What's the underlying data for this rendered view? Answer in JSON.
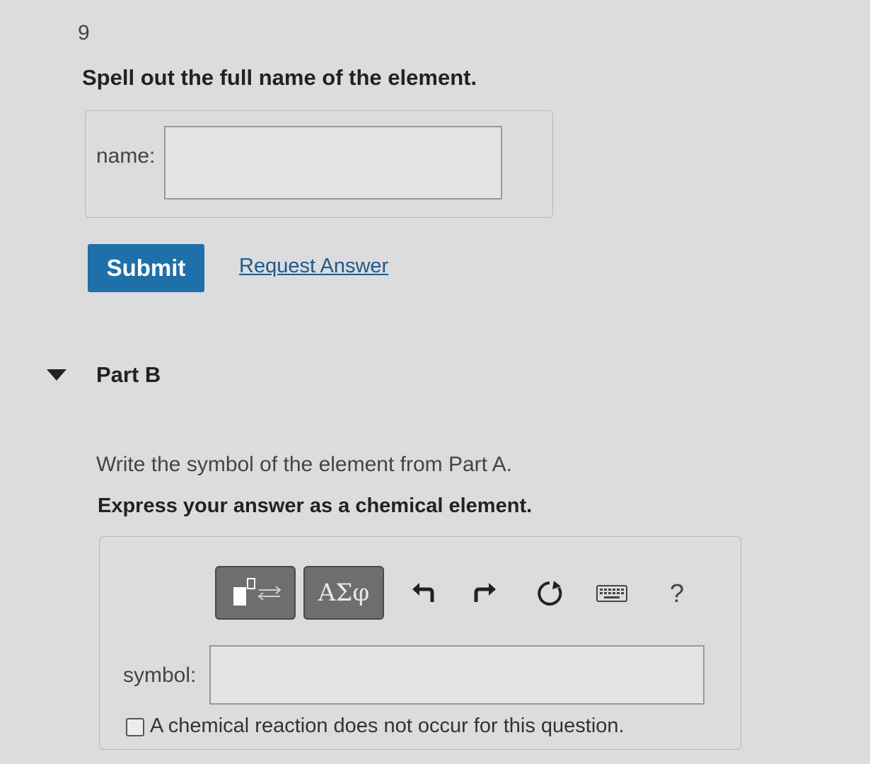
{
  "part_a": {
    "number": "9",
    "instruction": "Spell out the full name of the element.",
    "field_label": "name:",
    "field_value": ""
  },
  "actions": {
    "submit_label": "Submit",
    "request_label": "Request Answer"
  },
  "part_b": {
    "title": "Part B",
    "prompt": "Write the symbol of the element from Part A.",
    "express": "Express your answer as a chemical element.",
    "toolbar": {
      "greek_label": "ΑΣφ",
      "help_label": "?",
      "icons": [
        "templates-icon",
        "greek-symbols-icon",
        "undo-icon",
        "redo-icon",
        "reset-icon",
        "keyboard-icon",
        "help-icon"
      ]
    },
    "field_label": "symbol:",
    "field_value": "",
    "checkbox_label": "A chemical reaction does not occur for this question.",
    "checkbox_checked": false
  },
  "colors": {
    "accent": "#1f6fa8",
    "link": "#1e5a8a",
    "toolbar_button": "#6e6e70"
  }
}
